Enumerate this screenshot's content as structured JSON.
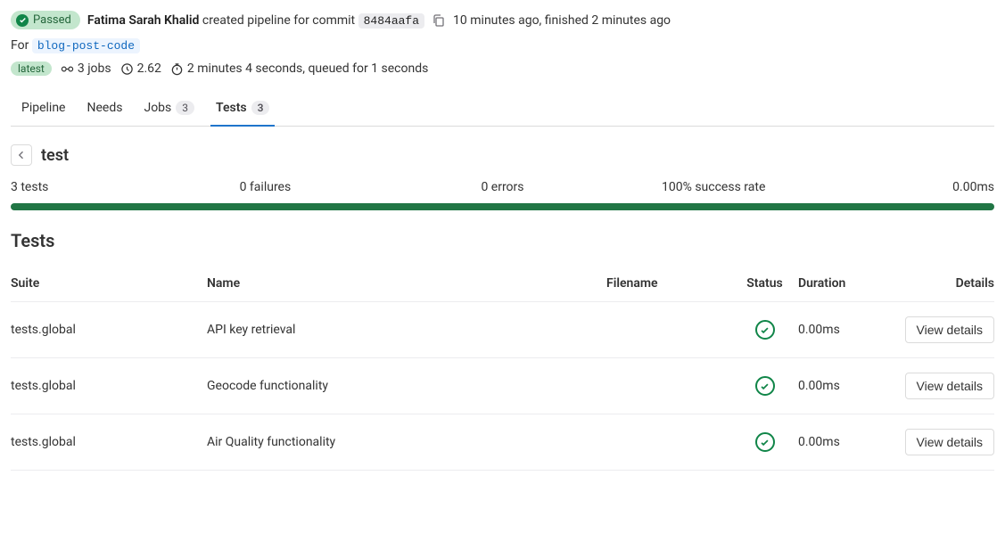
{
  "header": {
    "status": "Passed",
    "author": "Fatima Sarah Khalid",
    "action": "created pipeline for commit",
    "commit": "8484aafa",
    "timing": "10 minutes ago, finished 2 minutes ago"
  },
  "for": {
    "label": "For",
    "branch": "blog-post-code"
  },
  "meta": {
    "latest": "latest",
    "jobs": "3 jobs",
    "coverage": "2.62",
    "duration": "2 minutes 4 seconds, queued for 1 seconds"
  },
  "tabs": [
    {
      "label": "Pipeline",
      "count": null,
      "active": false
    },
    {
      "label": "Needs",
      "count": null,
      "active": false
    },
    {
      "label": "Jobs",
      "count": "3",
      "active": false
    },
    {
      "label": "Tests",
      "count": "3",
      "active": true
    }
  ],
  "suite": {
    "title": "test"
  },
  "stats": {
    "tests": "3 tests",
    "failures": "0 failures",
    "errors": "0 errors",
    "success": "100% success rate",
    "time": "0.00ms"
  },
  "tests_heading": "Tests",
  "columns": {
    "suite": "Suite",
    "name": "Name",
    "filename": "Filename",
    "status": "Status",
    "duration": "Duration",
    "details": "Details"
  },
  "tests": [
    {
      "suite": "tests.global",
      "name": "API key retrieval",
      "filename": "",
      "duration": "0.00ms",
      "button": "View details"
    },
    {
      "suite": "tests.global",
      "name": "Geocode functionality",
      "filename": "",
      "duration": "0.00ms",
      "button": "View details"
    },
    {
      "suite": "tests.global",
      "name": "Air Quality functionality",
      "filename": "",
      "duration": "0.00ms",
      "button": "View details"
    }
  ]
}
